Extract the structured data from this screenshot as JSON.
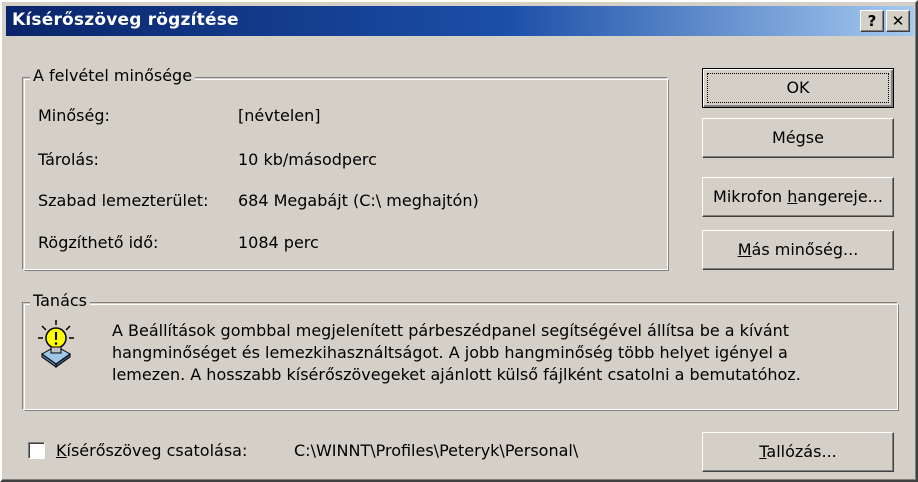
{
  "window": {
    "title": "Kísérőszöveg rögzítése",
    "help_glyph": "?",
    "close_glyph": "✕"
  },
  "quality_group": {
    "label": "A felvétel minősége",
    "rows": [
      {
        "label": "Minőség:",
        "value": "[névtelen]"
      },
      {
        "label": "Tárolás:",
        "value": "10 kb/másodperc"
      },
      {
        "label": "Szabad lemezterület:",
        "value": "684 Megabájt (C:\\ meghajtón)"
      },
      {
        "label": "Rögzíthető idő:",
        "value": "1084 perc"
      }
    ]
  },
  "buttons": {
    "ok": "OK",
    "cancel": "Mégse",
    "mic_prefix": "Mikrofon ",
    "mic_underlined": "h",
    "mic_suffix": "angereje...",
    "quality_prefix": "",
    "quality_underlined": "M",
    "quality_suffix": "ás minőség...",
    "browse_underlined": "T",
    "browse_suffix": "allózás..."
  },
  "hint_group": {
    "label": "Tanács",
    "icon": "lightbulb-icon",
    "lines": [
      "A Beállítások gombbal megjelenített párbeszédpanel segítségével állítsa be a kívánt",
      "hangminőséget és lemezkihasználtságot. A jobb hangminőség több helyet igényel a",
      "lemezen. A hosszabb kísérőszövegeket ajánlott külső fájlként csatolni a bemutatóhoz."
    ]
  },
  "link": {
    "checkbox_checked": false,
    "label_underlined": "K",
    "label_suffix": "ísérőszöveg csatolása:",
    "path": "C:\\WINNT\\Profiles\\Peteryk\\Personal\\"
  },
  "colors": {
    "face": "#d4d0c8",
    "title_start": "#0a246a",
    "title_end": "#a6caf0"
  }
}
